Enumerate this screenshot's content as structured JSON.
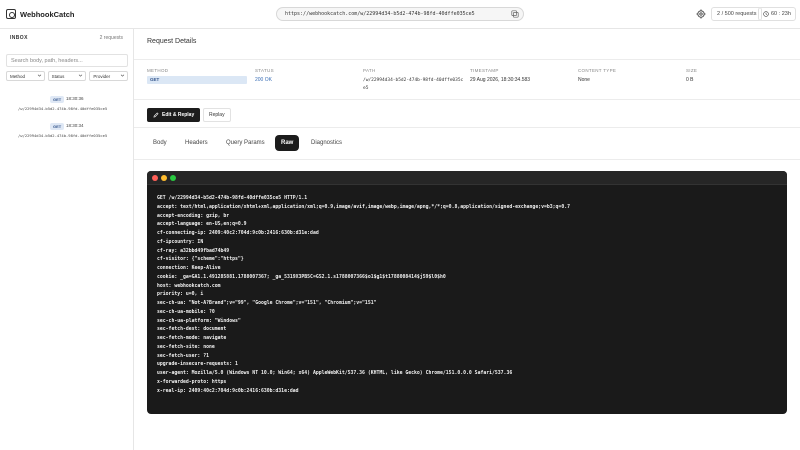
{
  "header": {
    "brand": "WebhookCatch",
    "url": "https://webhookcatch.com/w/22994d34-b5d2-474b-98fd-40dffe035ce5",
    "request_count": "2 / 500 requests",
    "timer": "60 : 23h"
  },
  "sidebar": {
    "title": "INBOX",
    "count": "2 requests",
    "search_placeholder": "Search body, path, headers...",
    "filters": [
      "Method",
      "Status",
      "Provider"
    ],
    "requests": [
      {
        "method": "GET",
        "time": "18:30:36",
        "path": "/w/22994d34-b5d2-474b-98fd-40dffe035ce5"
      },
      {
        "method": "GET",
        "time": "18:30:34",
        "path": "/w/22994d34-b5d2-474b-98fd-40dffe035ce5"
      }
    ]
  },
  "main": {
    "title": "Request Details",
    "meta": {
      "method_label": "METHOD",
      "method": "GET",
      "status_label": "STATUS",
      "status": "200 OK",
      "path_label": "PATH",
      "path": "/w/22994d34-b5d2-474b-98fd-40dffe035ce5",
      "timestamp_label": "TIMESTAMP",
      "timestamp": "29 Aug 2026, 18:30:34.583",
      "content_type_label": "CONTENT TYPE",
      "content_type": "None",
      "size_label": "SIZE",
      "size": "0 B"
    },
    "actions": {
      "edit_replay": "Edit & Replay",
      "replay": "Replay"
    },
    "tabs": [
      "Body",
      "Headers",
      "Query Params",
      "Raw",
      "Diagnostics"
    ],
    "active_tab": "Raw",
    "raw": "GET /w/22994d34-b5d2-474b-98fd-40dffe035ce5 HTTP/1.1\naccept: text/html,application/xhtml+xml,application/xml;q=0.9,image/avif,image/webp,image/apng,*/*;q=0.8,application/signed-exchange;v=b3;q=0.7\naccept-encoding: gzip, br\naccept-language: en-US,en;q=0.9\ncf-connecting-ip: 2409:40c2:704d:9c0b:2416:630b:d31e:dad\ncf-ipcountry: IN\ncf-ray: a32bbd49fbad74b49\ncf-visitor: {\"scheme\":\"https\"}\nconnection: Keep-Alive\ncookie: _ga=GA1.1.491285881.1788007367; _ga_5319X3PB5C=GS2.1.s1788007366$o1$g1$t1788008414$j59$l0$h0\nhost: webhookcatch.com\npriority: u=0, i\nsec-ch-ua: \"Not-A?Brand\";v=\"99\", \"Google Chrome\";v=\"151\", \"Chromium\";v=\"151\"\nsec-ch-ua-mobile: ?0\nsec-ch-ua-platform: \"Windows\"\nsec-fetch-dest: document\nsec-fetch-mode: navigate\nsec-fetch-site: none\nsec-fetch-user: ?1\nupgrade-insecure-requests: 1\nuser-agent: Mozilla/5.0 (Windows NT 10.0; Win64; x64) AppleWebKit/537.36 (KHTML, like Gecko) Chrome/151.0.0.0 Safari/537.36\nx-forwarded-proto: https\nx-real-ip: 2409:40c2:704d:9c0b:2416:630b:d31e:dad"
  },
  "colors": {
    "accent_dark": "#1c1c1c",
    "method_badge_bg": "#dbe7f5",
    "method_badge_text": "#34558b",
    "status_ok": "#3b6fb6",
    "terminal_bg": "#1a1a1a"
  },
  "icons": [
    "logo-icon",
    "copy-icon",
    "gear-icon",
    "clock-icon",
    "chevron-down-icon",
    "edit-icon"
  ]
}
